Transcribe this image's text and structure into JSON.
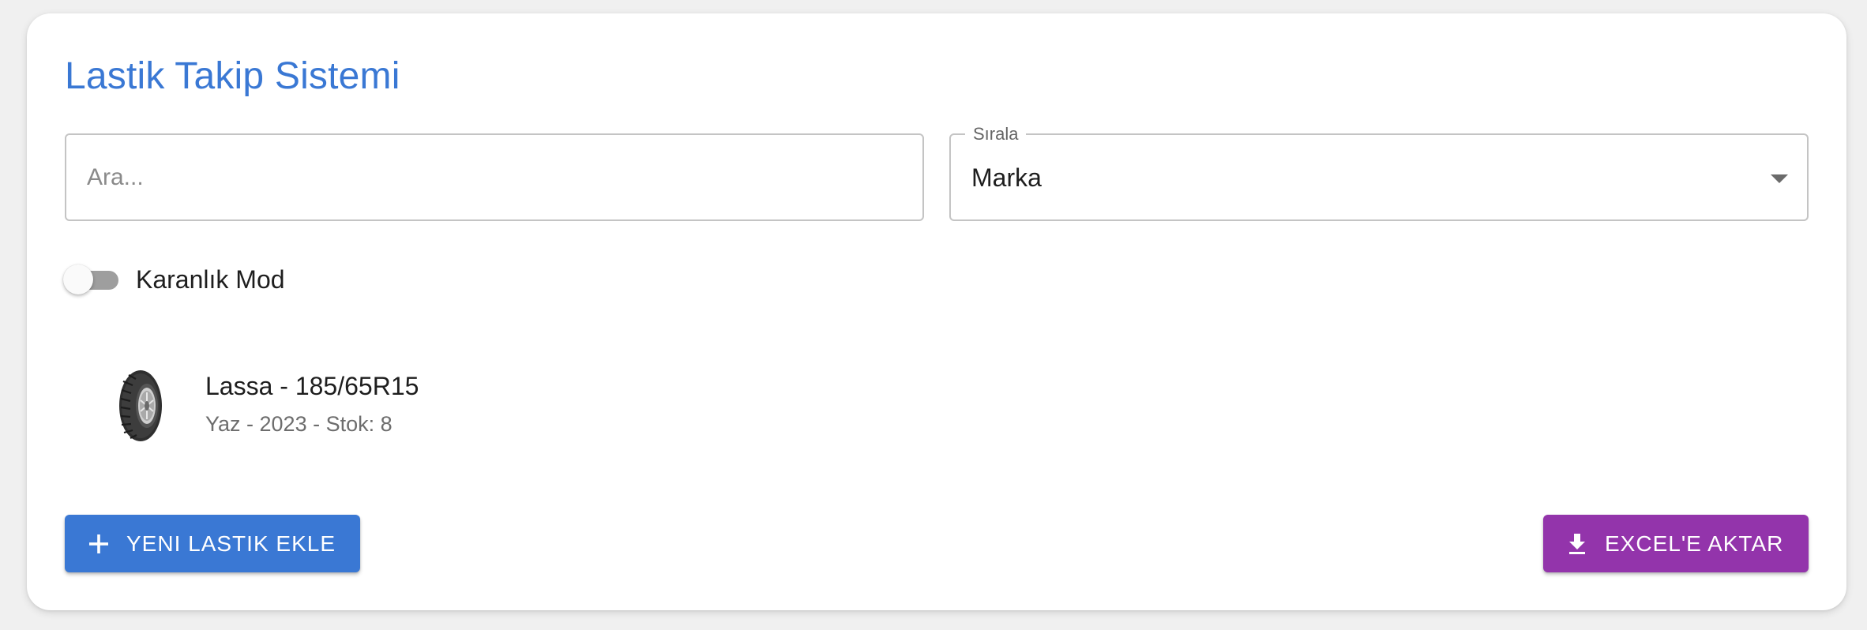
{
  "app": {
    "title": "Lastik Takip Sistemi"
  },
  "search": {
    "placeholder": "Ara...",
    "value": ""
  },
  "sort": {
    "label": "Sırala",
    "selected": "Marka"
  },
  "dark_mode": {
    "label": "Karanlık Mod",
    "enabled": false
  },
  "tires": [
    {
      "title": "Lassa - 185/65R15",
      "subtitle": "Yaz - 2023 - Stok: 8",
      "icon": "tire-icon"
    }
  ],
  "actions": {
    "add_label": "YENI LASTIK EKLE",
    "add_icon": "plus-icon",
    "export_label": "EXCEL'E AKTAR",
    "export_icon": "download-icon"
  },
  "colors": {
    "primary": "#3a78d4",
    "export": "#9334ab",
    "switch_track_off": "#9e9e9e"
  }
}
